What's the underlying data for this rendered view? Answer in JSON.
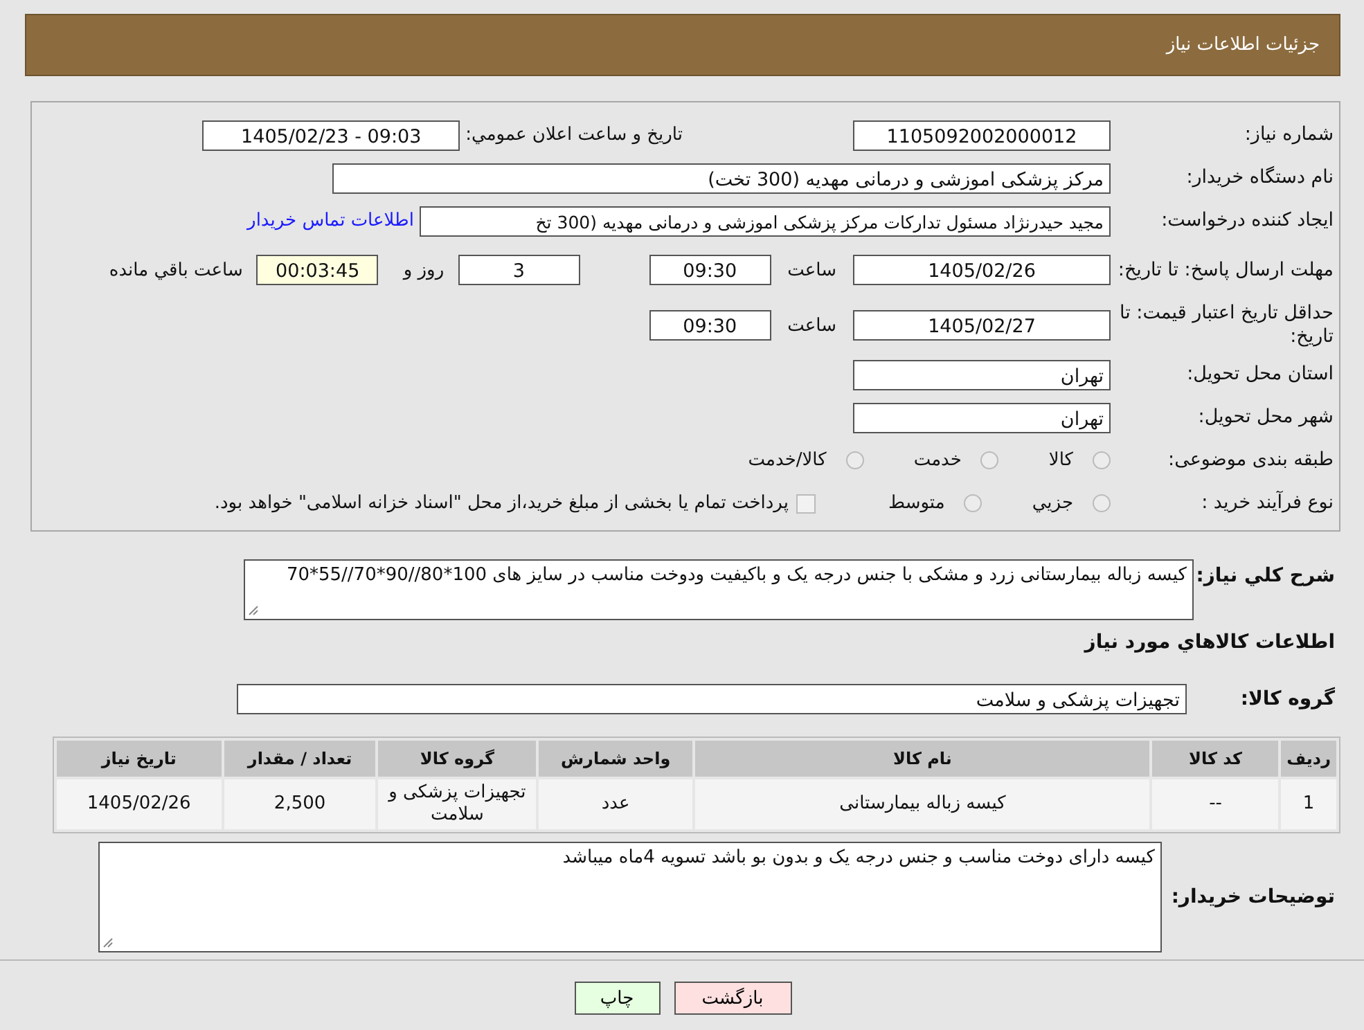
{
  "header": {
    "title": "جزئیات اطلاعات نیاز"
  },
  "need_number": {
    "label": "شماره نیاز:",
    "value": "1105092002000012"
  },
  "announce": {
    "label": "تاریخ و ساعت اعلان عمومي:",
    "value": "1405/02/23 - 09:03"
  },
  "buyer": {
    "label": "نام دستگاه خریدار:",
    "value": "مرکز پزشکی  اموزشی و درمانی مهدیه (300 تخت)"
  },
  "creator": {
    "label": "ایجاد کننده درخواست:",
    "value": "مجید حیدرنژاد مسئول تدارکات مرکز پزشکی  اموزشی و درمانی مهدیه (300 تخ",
    "link": "اطلاعات تماس خریدار"
  },
  "reply_deadline": {
    "label": "مهلت ارسال پاسخ: تا تاریخ:",
    "date": "1405/02/26",
    "time_label": "ساعت",
    "time": "09:30",
    "days": "3",
    "days_label": "روز و",
    "remaining": "00:03:45",
    "remaining_label": "ساعت باقي مانده"
  },
  "price_validity": {
    "label": "حداقل تاریخ اعتبار قیمت: تا تاریخ:",
    "date": "1405/02/27",
    "time_label": "ساعت",
    "time": "09:30"
  },
  "province": {
    "label": "استان محل تحویل:",
    "value": "تهران"
  },
  "city": {
    "label": "شهر محل تحویل:",
    "value": "تهران"
  },
  "category": {
    "label": "طبقه بندی موضوعی:",
    "options": [
      {
        "label": "کالا",
        "selected": false
      },
      {
        "label": "خدمت",
        "selected": false
      },
      {
        "label": "کالا/خدمت",
        "selected": false
      }
    ]
  },
  "purchase_type": {
    "label": "نوع فرآیند خرید :",
    "options": [
      {
        "label": "جزيي",
        "selected": false
      },
      {
        "label": "متوسط",
        "selected": false
      }
    ],
    "payment": {
      "checked": false,
      "text": "پرداخت تمام یا بخشی از مبلغ خرید،از محل \"اسناد خزانه اسلامی\" خواهد بود."
    }
  },
  "description": {
    "label": "شرح كلي نياز:",
    "value": "کیسه زباله بیمارستانی زرد و مشکی با جنس درجه یک و باکیفیت ودوخت مناسب در سایز های 100*80//90*70//55*70"
  },
  "goods_heading": "اطلاعات كالاهاي مورد نياز",
  "goods_group": {
    "label": "گروه کالا:",
    "value": "تجهیزات پزشکی و سلامت"
  },
  "table": {
    "columns": [
      "رديف",
      "کد کالا",
      "نام کالا",
      "واحد شمارش",
      "گروه کالا",
      "تعداد / مقدار",
      "تاریخ نیاز"
    ],
    "rows": [
      [
        "1",
        "--",
        "کیسه زباله بیمارستانی",
        "عدد",
        "تجهیزات پزشکی و سلامت",
        "2,500",
        "1405/02/26"
      ]
    ]
  },
  "buyer_notes": {
    "label": "توضیحات خریدار:",
    "value": "کیسه دارای دوخت مناسب و جنس درجه یک و بدون بو باشد تسویه 4ماه میباشد"
  },
  "buttons": [
    {
      "label": "بازگشت",
      "kind": "back"
    },
    {
      "label": "چاپ",
      "kind": "print"
    }
  ]
}
